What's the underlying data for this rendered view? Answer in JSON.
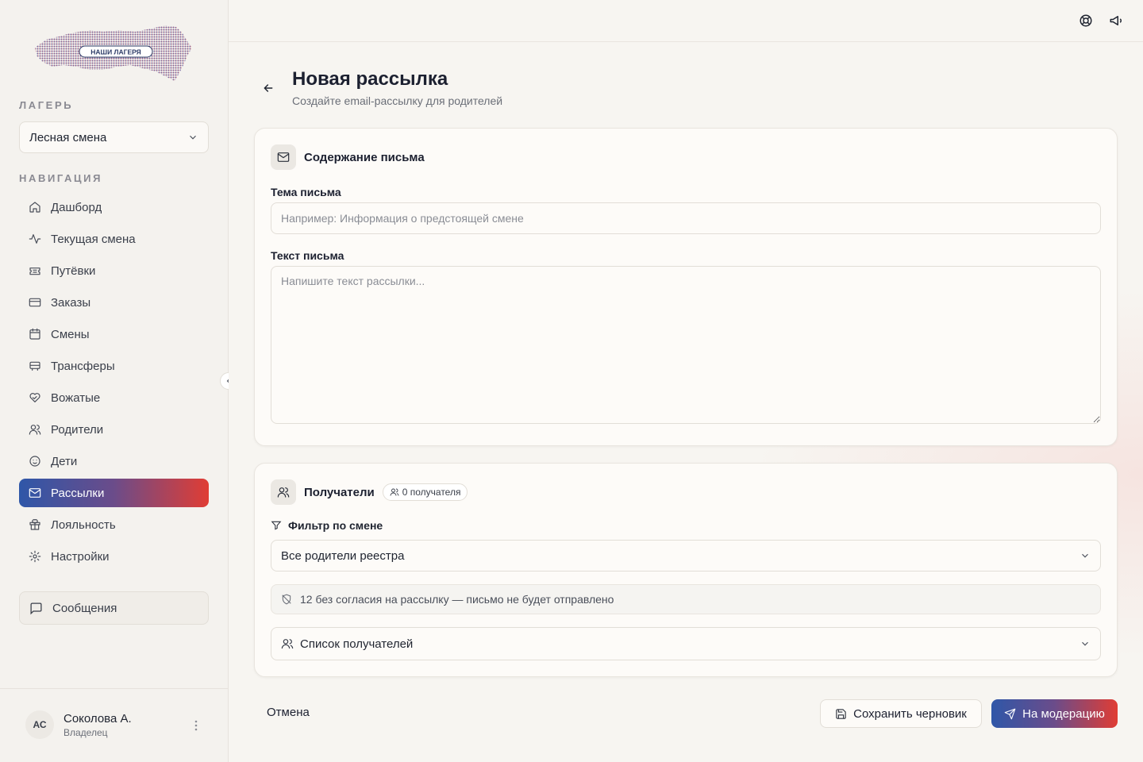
{
  "sidebar": {
    "logo_text": "НАШИ ЛАГЕРЯ",
    "camp_section_label": "ЛАГЕРЬ",
    "camp_selected": "Лесная смена",
    "nav_section_label": "НАВИГАЦИЯ",
    "nav_items": [
      {
        "label": "Дашборд",
        "icon": "home-icon"
      },
      {
        "label": "Текущая смена",
        "icon": "activity-icon"
      },
      {
        "label": "Путёвки",
        "icon": "ticket-icon"
      },
      {
        "label": "Заказы",
        "icon": "credit-card-icon"
      },
      {
        "label": "Смены",
        "icon": "calendar-icon"
      },
      {
        "label": "Трансферы",
        "icon": "bus-icon"
      },
      {
        "label": "Вожатые",
        "icon": "heart-handshake-icon"
      },
      {
        "label": "Родители",
        "icon": "users-icon"
      },
      {
        "label": "Дети",
        "icon": "baby-icon"
      },
      {
        "label": "Рассылки",
        "icon": "mail-icon",
        "active": true
      },
      {
        "label": "Лояльность",
        "icon": "gift-icon"
      },
      {
        "label": "Настройки",
        "icon": "gear-icon"
      }
    ],
    "messages_label": "Сообщения",
    "user": {
      "initials": "АС",
      "name": "Соколова А.",
      "role": "Владелец"
    }
  },
  "header": {
    "title": "Новая рассылка",
    "subtitle": "Создайте email-рассылку для родителей"
  },
  "content_card": {
    "title": "Содержание письма",
    "subject_label": "Тема письма",
    "subject_value": "",
    "subject_placeholder": "Например: Информация о предстоящей смене",
    "body_label": "Текст письма",
    "body_value": "",
    "body_placeholder": "Напишите текст рассылки..."
  },
  "recipients_card": {
    "title": "Получатели",
    "count_badge": "0 получателя",
    "filter_label": "Фильтр по смене",
    "filter_selected": "Все родители реестра",
    "notice": "12 без согласия на рассылку — письмо не будет отправлено",
    "list_label": "Список получателей"
  },
  "actions": {
    "cancel": "Отмена",
    "save_draft": "Сохранить черновик",
    "submit": "На модерацию"
  },
  "colors": {
    "accent_start": "#2f57a8",
    "accent_end": "#e03d34",
    "background": "#f7f5f1"
  }
}
